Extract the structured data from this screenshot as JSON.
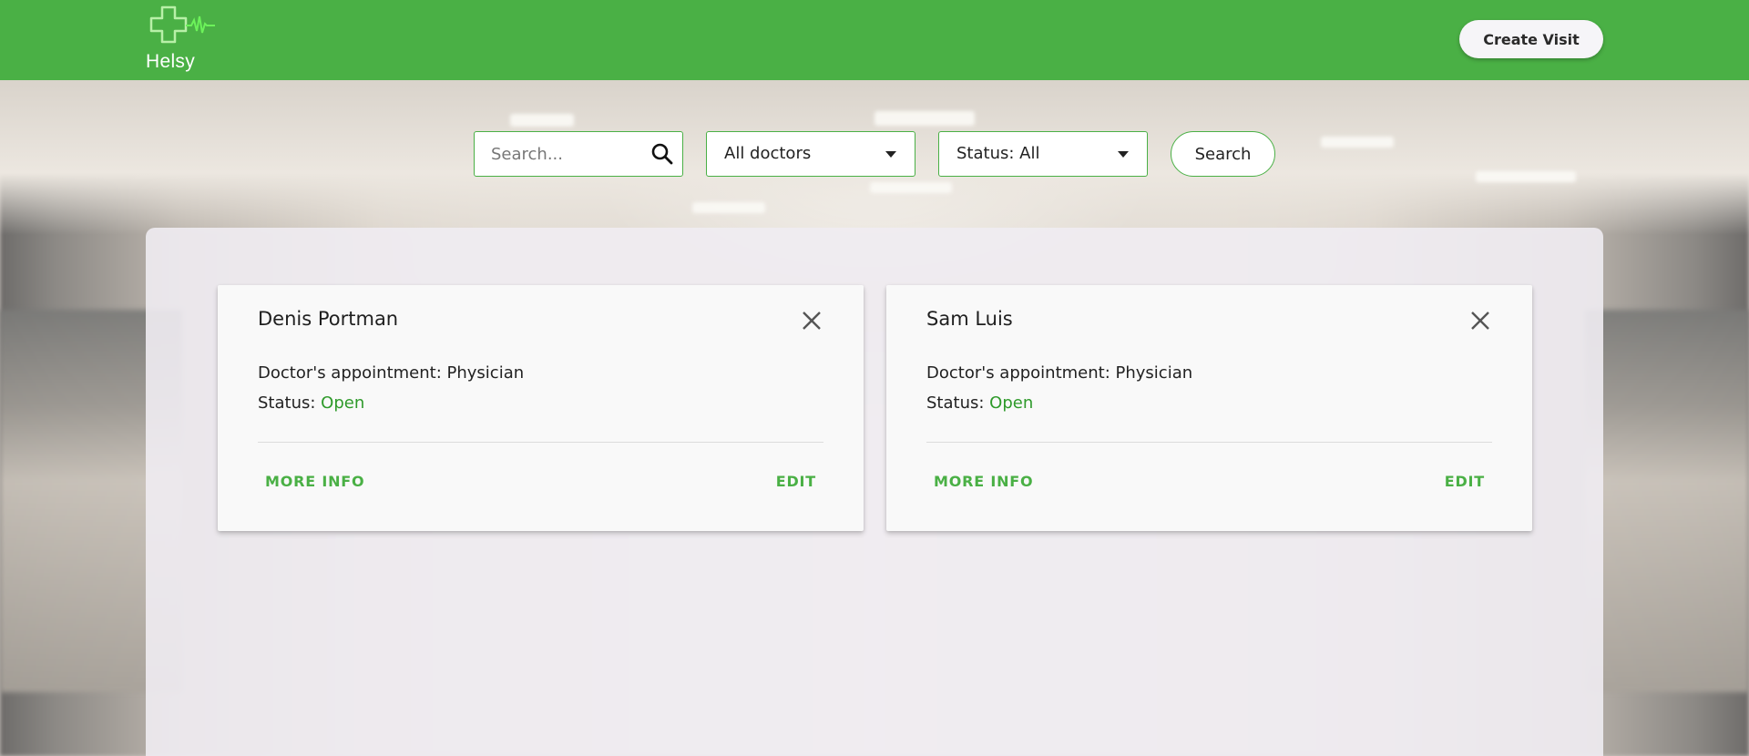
{
  "header": {
    "logo_text": "Helsy",
    "create_visit_label": "Create Visit",
    "background_color": "#4ab045"
  },
  "filters": {
    "search_placeholder": "Search...",
    "doctor_select_value": "All doctors",
    "status_select_value": "Status: All",
    "search_button_label": "Search"
  },
  "cards": [
    {
      "name": "Denis Portman",
      "appointment": "Doctor's appointment: Physician",
      "status_label": "Status:",
      "status_value": "Open",
      "more_info_label": "MORE INFO",
      "edit_label": "EDIT"
    },
    {
      "name": "Sam Luis",
      "appointment": "Doctor's appointment: Physician",
      "status_label": "Status:",
      "status_value": "Open",
      "more_info_label": "MORE INFO",
      "edit_label": "EDIT"
    }
  ],
  "colors": {
    "accent": "#4ab045",
    "status_open": "#2e9a2a"
  }
}
